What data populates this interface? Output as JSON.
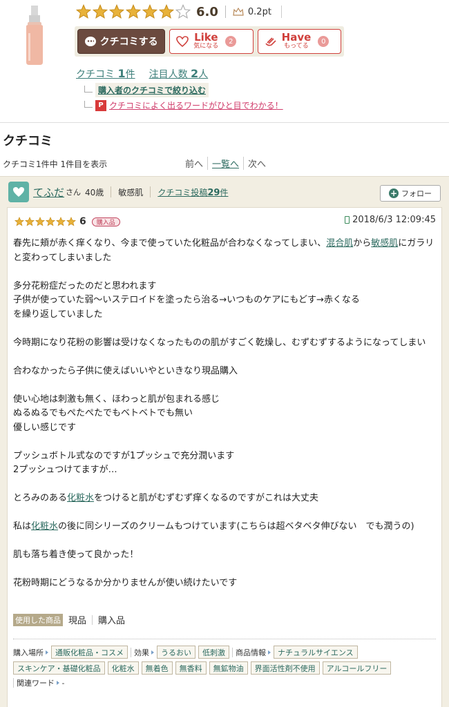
{
  "product": {
    "rating": "6.0",
    "points": "0.2pt",
    "stars_filled": 6,
    "stars_total": 7
  },
  "buttons": {
    "kuchikomi": "クチコミする",
    "like_main": "Like",
    "like_sub": "気になる",
    "like_count": "2",
    "have_main": "Have",
    "have_sub": "もってる",
    "have_count": "0"
  },
  "stats": {
    "kuchikomi_label": "クチコミ",
    "kuchikomi_num": "1",
    "kuchikomi_unit": "件",
    "attention_label": "注目人数",
    "attention_num": "2",
    "attention_unit": "人"
  },
  "filter_link": "購入者のクチコミで絞り込む",
  "word_icon": "P",
  "word_link": "クチコミによく出るワードがひと目でわかる！",
  "section": {
    "title": "クチコミ",
    "count_text": "クチコミ1件中 1件目を表示",
    "pager": {
      "prev": "前へ",
      "list": "一覧へ",
      "next": "次へ"
    }
  },
  "review": {
    "user_name": "てふだ",
    "user_san": "さん",
    "user_age": "40歳",
    "skin_type": "敏感肌",
    "posts_label": "クチコミ投稿",
    "posts_count": "29",
    "posts_unit": "件",
    "follow_label": "フォロー",
    "score": "6",
    "stars": 6,
    "badge": "購入品",
    "date": "2018/6/3 12:09:45",
    "text": {
      "p1_a": "春先に頬が赤く痒くなり、今まで使っていた化粧品が合わなくなってしまい、",
      "p1_link1": "混合肌",
      "p1_b": "から",
      "p1_link2": "敏感肌",
      "p1_c": "にガラリと変わってしまいました",
      "p2_l1": "多分花粉症だったのだと思われます",
      "p2_l2": "子供が使っていた弱〜いステロイドを塗ったら治る→いつものケアにもどす→赤くなる",
      "p2_l3": "を繰り返していました",
      "p3": "今時期になり花粉の影響は受けなくなったものの肌がすごく乾燥し、むずむずするようになってしまい",
      "p4": "合わなかったら子供に使えばいいやといきなり現品購入",
      "p5_l1": "使い心地は刺激も無く、ほわっと肌が包まれる感じ",
      "p5_l2": "ぬるぬるでもぺたぺたでもベトベトでも無い",
      "p5_l3": "優しい感じです",
      "p6_l1": "プッシュボトル式なのですが1プッシュで充分潤います",
      "p6_l2": "2プッシュつけてますが…",
      "p7_a": "とろみのある",
      "p7_link": "化粧水",
      "p7_b": "をつけると肌がむずむず痒くなるのですがこれは大丈夫",
      "p8_a": "私は",
      "p8_link": "化粧水",
      "p8_b": "の後に同シリーズのクリームもつけています(こちらは超ベタベタ伸びない　でも潤うの)",
      "p9": "肌も落ち着き使って良かった！",
      "p10": "花粉時期にどうなるか分かりませんが使い続けたいです"
    },
    "used_label": "使用した商品",
    "used_item1": "現品",
    "used_item2": "購入品",
    "tags": {
      "place_label": "購入場所",
      "place": "通販化粧品・コスメ",
      "effect_label": "効果",
      "effects": [
        "うるおい",
        "低刺激"
      ],
      "info_label": "商品情報",
      "info": [
        "ナチュラルサイエンス"
      ],
      "row2": [
        "スキンケア・基礎化粧品",
        "化粧水",
        "無着色",
        "無香料",
        "無鉱物油",
        "界面活性剤不使用",
        "アルコールフリー"
      ],
      "related_label": "関連ワード",
      "related_value": "-"
    }
  },
  "colors": {
    "star": "#e8b23a",
    "brown": "#6b4a3f",
    "accent_red": "#d0403c",
    "link_green": "#2c6a5f",
    "review_bg": "#f2eee2"
  }
}
